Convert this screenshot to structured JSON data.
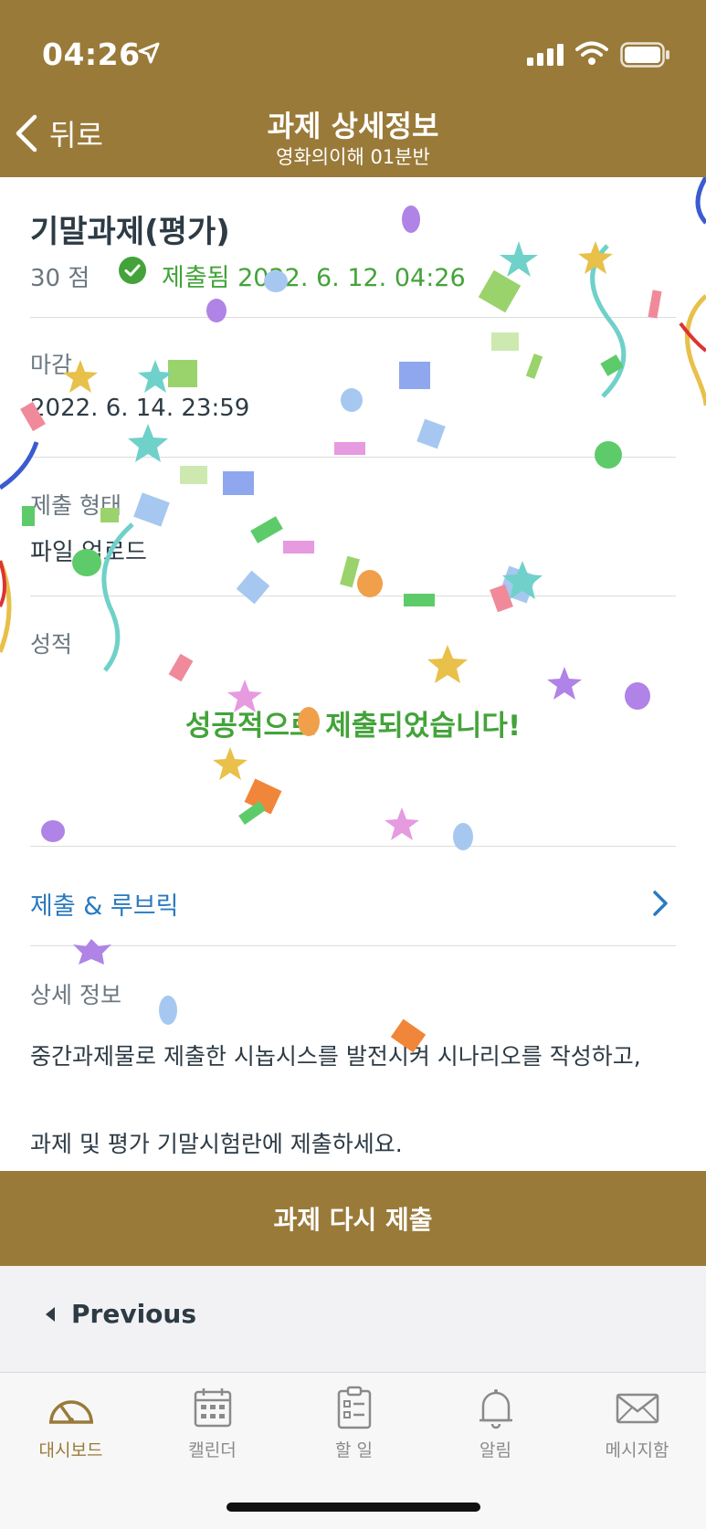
{
  "status_bar": {
    "time": "04:26"
  },
  "header": {
    "back_label": "뒤로",
    "title": "과제 상세정보",
    "subtitle": "영화의이해 01분반"
  },
  "assignment": {
    "title": "기말과제(평가)",
    "points": "30 점",
    "submitted_status": "제출됨 2022. 6. 12. 04:26"
  },
  "sections": {
    "due_label": "마감",
    "due_value": "2022. 6. 14. 23:59",
    "submission_type_label": "제출 형태",
    "submission_type_value": "파일 업로드",
    "grade_label": "성적",
    "success_message": "성공적으로 제출되었습니다!",
    "rubric_link": "제출 & 루브릭",
    "details_label": "상세 정보",
    "details_line1": "중간과제물로 제출한 시놉시스를 발전시켜 시나리오를 작성하고,",
    "details_line2": "과제 및 평가 기말시험란에 제출하세요."
  },
  "actions": {
    "resubmit_label": "과제 다시 제출",
    "previous_label": "Previous"
  },
  "tabbar": {
    "items": [
      {
        "label": "대시보드",
        "icon": "dashboard-icon",
        "active": true
      },
      {
        "label": "캘린더",
        "icon": "calendar-icon",
        "active": false
      },
      {
        "label": "할 일",
        "icon": "todo-icon",
        "active": false
      },
      {
        "label": "알림",
        "icon": "bell-icon",
        "active": false
      },
      {
        "label": "메시지함",
        "icon": "mail-icon",
        "active": false
      }
    ]
  },
  "colors": {
    "brand": "#9a7a39",
    "success": "#43a33a",
    "link": "#2a7abf",
    "text": "#2d3b45",
    "muted": "#6b7780"
  }
}
